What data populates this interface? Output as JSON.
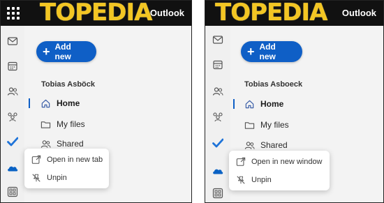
{
  "colors": {
    "topbar": "#111111",
    "logo": "#f3c623",
    "accent": "#0f5fc6",
    "rail": "#f0f0f0",
    "nav": "#f3f3f3",
    "todo_check": "#1e73d8",
    "onedrive_cloud": "#0a62c4"
  },
  "left": {
    "logo_text": "TOPEDIA",
    "app_title": "Outlook",
    "add_new_label": "Add new",
    "user_name": "Tobias Asböck",
    "nav": {
      "home": "Home",
      "my_files": "My files",
      "shared": "Shared"
    },
    "menu": {
      "open": "Open in new tab",
      "unpin": "Unpin"
    }
  },
  "right": {
    "logo_text": "TOPEDIA",
    "app_title": "Outlook",
    "add_new_label": "Add new",
    "user_name": "Tobias Asboeck",
    "nav": {
      "home": "Home",
      "my_files": "My files",
      "shared": "Shared"
    },
    "menu": {
      "open": "Open in new window",
      "unpin": "Unpin"
    }
  },
  "icons": {
    "app_launcher": "waffle-icon",
    "rail": [
      "mail-icon",
      "calendar-icon",
      "people-icon",
      "groups-icon",
      "todo-check-icon",
      "onedrive-cloud-icon",
      "more-apps-icon"
    ],
    "nav": [
      "home-icon",
      "folder-icon",
      "shared-people-icon"
    ],
    "menu": [
      "open-external-icon",
      "unpin-icon"
    ]
  }
}
